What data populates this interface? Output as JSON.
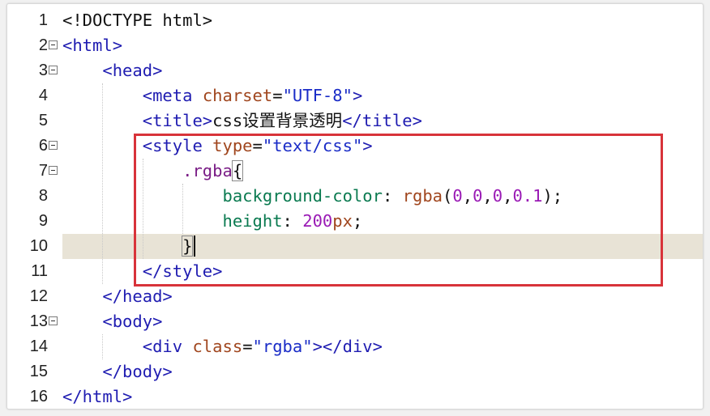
{
  "editor": {
    "highlight_color": "#d8333a",
    "current_line": 10,
    "lines": [
      {
        "num": "1",
        "fold": false,
        "segments": [
          {
            "t": "<!DOCTYPE html>",
            "c": "dark"
          }
        ]
      },
      {
        "num": "2",
        "fold": true,
        "segments": [
          {
            "t": "<html>",
            "c": "tag"
          }
        ]
      },
      {
        "num": "3",
        "fold": true,
        "segments": [
          {
            "t": "    "
          },
          {
            "t": "<head>",
            "c": "tag"
          }
        ]
      },
      {
        "num": "4",
        "fold": false,
        "segments": [
          {
            "t": "        "
          },
          {
            "t": "<meta ",
            "c": "tag"
          },
          {
            "t": "charset",
            "c": "attr"
          },
          {
            "t": "=",
            "c": "pun"
          },
          {
            "t": "\"UTF-8\"",
            "c": "str"
          },
          {
            "t": ">",
            "c": "tag"
          }
        ]
      },
      {
        "num": "5",
        "fold": false,
        "segments": [
          {
            "t": "        "
          },
          {
            "t": "<title>",
            "c": "tag"
          },
          {
            "t": "css设置背景透明",
            "c": "dark"
          },
          {
            "t": "</title>",
            "c": "tag"
          }
        ]
      },
      {
        "num": "6",
        "fold": true,
        "segments": [
          {
            "t": "        "
          },
          {
            "t": "<style ",
            "c": "tag"
          },
          {
            "t": "type",
            "c": "attr"
          },
          {
            "t": "=",
            "c": "pun"
          },
          {
            "t": "\"text/css\"",
            "c": "str"
          },
          {
            "t": ">",
            "c": "tag"
          }
        ]
      },
      {
        "num": "7",
        "fold": true,
        "segments": [
          {
            "t": "            "
          },
          {
            "t": ".rgba",
            "c": "sel"
          },
          {
            "t": "{",
            "c": "pun",
            "box": true
          }
        ]
      },
      {
        "num": "8",
        "fold": false,
        "segments": [
          {
            "t": "                "
          },
          {
            "t": "background-color",
            "c": "prop"
          },
          {
            "t": ": ",
            "c": "pun"
          },
          {
            "t": "rgba",
            "c": "attr"
          },
          {
            "t": "(",
            "c": "pun"
          },
          {
            "t": "0",
            "c": "num"
          },
          {
            "t": ",",
            "c": "pun"
          },
          {
            "t": "0",
            "c": "num"
          },
          {
            "t": ",",
            "c": "pun"
          },
          {
            "t": "0",
            "c": "num"
          },
          {
            "t": ",",
            "c": "pun"
          },
          {
            "t": "0.1",
            "c": "num"
          },
          {
            "t": ");",
            "c": "pun"
          }
        ]
      },
      {
        "num": "9",
        "fold": false,
        "segments": [
          {
            "t": "                "
          },
          {
            "t": "height",
            "c": "prop"
          },
          {
            "t": ": ",
            "c": "pun"
          },
          {
            "t": "200",
            "c": "num"
          },
          {
            "t": "px",
            "c": "attr"
          },
          {
            "t": ";",
            "c": "pun"
          }
        ]
      },
      {
        "num": "10",
        "fold": false,
        "segments": [
          {
            "t": "            "
          },
          {
            "t": "}",
            "c": "pun",
            "box": true
          }
        ]
      },
      {
        "num": "11",
        "fold": false,
        "segments": [
          {
            "t": "        "
          },
          {
            "t": "</style>",
            "c": "tag"
          }
        ]
      },
      {
        "num": "12",
        "fold": false,
        "segments": [
          {
            "t": "    "
          },
          {
            "t": "</head>",
            "c": "tag"
          }
        ]
      },
      {
        "num": "13",
        "fold": true,
        "segments": [
          {
            "t": "    "
          },
          {
            "t": "<body>",
            "c": "tag"
          }
        ]
      },
      {
        "num": "14",
        "fold": false,
        "segments": [
          {
            "t": "        "
          },
          {
            "t": "<div ",
            "c": "tag"
          },
          {
            "t": "class",
            "c": "attr"
          },
          {
            "t": "=",
            "c": "pun"
          },
          {
            "t": "\"rgba\"",
            "c": "str"
          },
          {
            "t": "></div>",
            "c": "tag"
          }
        ]
      },
      {
        "num": "15",
        "fold": false,
        "segments": [
          {
            "t": "    "
          },
          {
            "t": "</body>",
            "c": "tag"
          }
        ]
      },
      {
        "num": "16",
        "fold": false,
        "segments": [
          {
            "t": "</html>",
            "c": "tag"
          }
        ]
      }
    ]
  }
}
